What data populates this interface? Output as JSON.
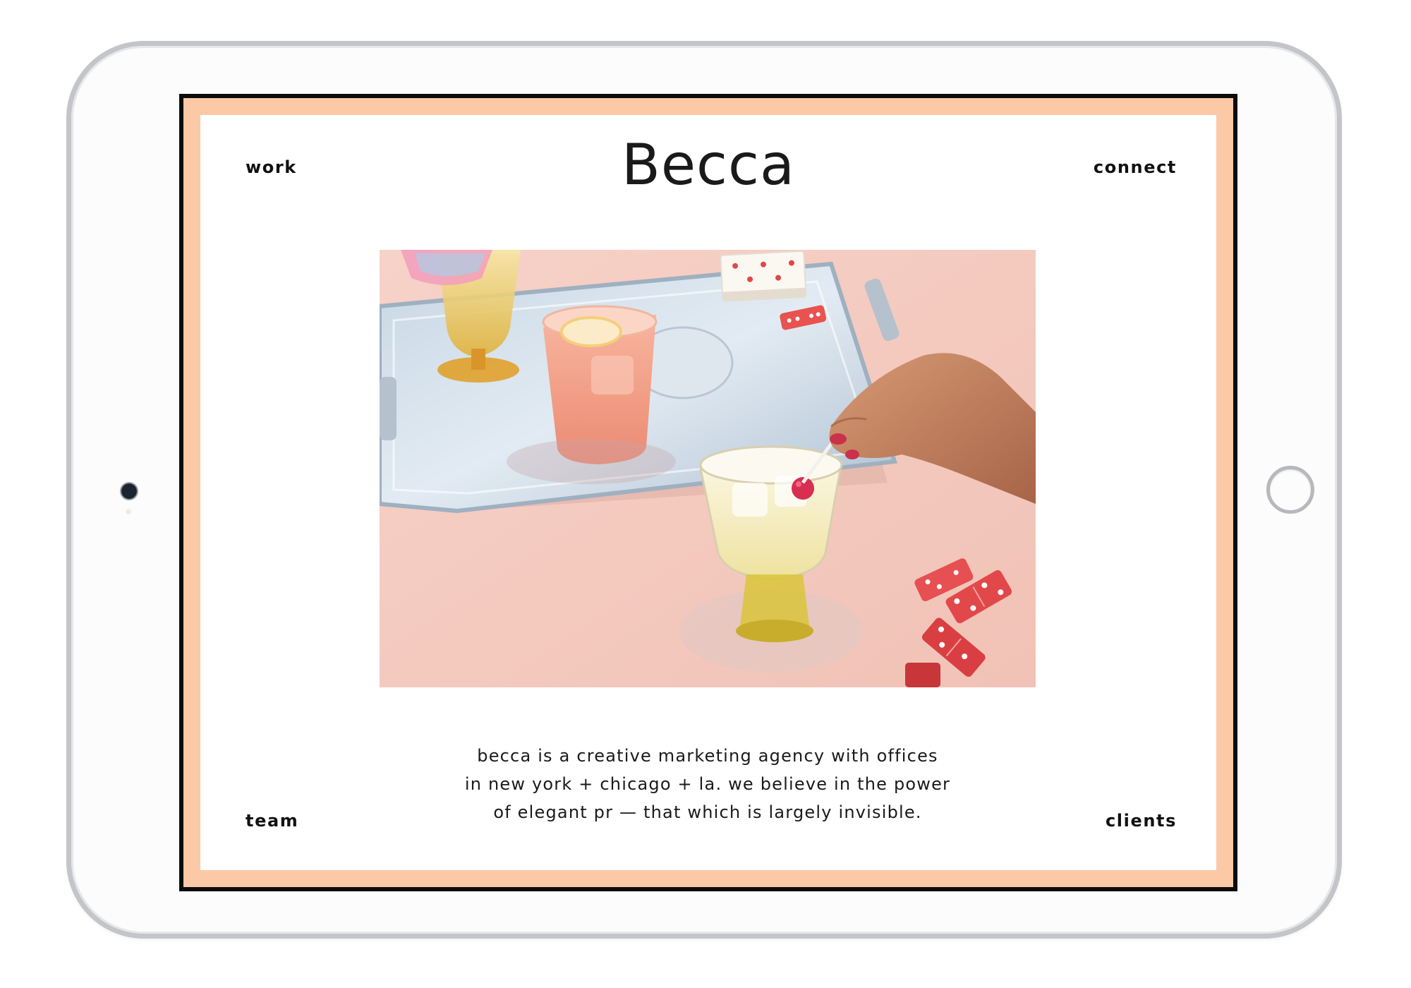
{
  "site": {
    "brand": "Becca"
  },
  "nav": {
    "work": "work",
    "connect": "connect",
    "team": "team",
    "clients": "clients"
  },
  "tagline": {
    "line1": "becca is a creative marketing agency with offices",
    "line2": "in new york + chicago + la. we believe in the power",
    "line3": "of elegant pr — that which is largely invisible."
  },
  "colors": {
    "frame_accent": "#fcc9a6",
    "screen_border": "#0c0c0c",
    "page_background": "#ffffff",
    "text": "#111111"
  }
}
